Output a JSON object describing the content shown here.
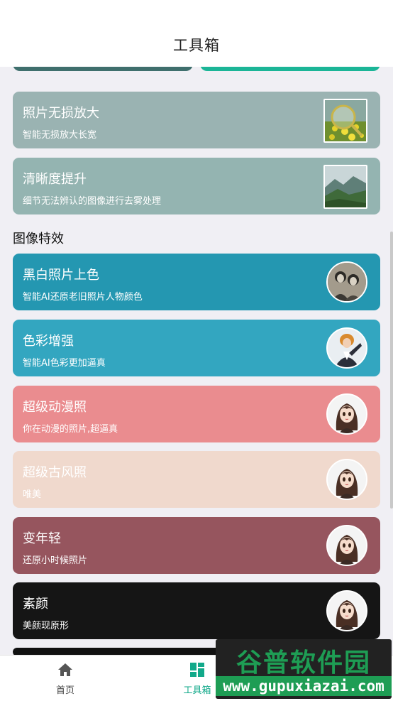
{
  "header": {
    "title": "工具箱"
  },
  "cards_upper": [
    {
      "title": "照片无损放大",
      "subtitle": "智能无损放大长宽",
      "color": "#9ab3b2",
      "thumb": "magnifier-flower-field-thumbnail"
    },
    {
      "title": "清晰度提升",
      "subtitle": "细节无法辨认的图像进行去雾处理",
      "color": "#94b4b1",
      "thumb": "mountain-landscape-thumbnail"
    }
  ],
  "section": {
    "title": "图像特效"
  },
  "effects": [
    {
      "title": "黑白照片上色",
      "subtitle": "智能AI还原老旧照片人物颜色",
      "color": "#2497b1",
      "thumb": "bw-portrait-avatar"
    },
    {
      "title": "色彩增强",
      "subtitle": "智能AI色彩更加逼真",
      "color": "#33a6c0",
      "thumb": "woman-portrait-avatar"
    },
    {
      "title": "超级动漫照",
      "subtitle": "你在动漫的照片,超逼真",
      "color": "#ea8c8f",
      "thumb": "anime-girl-avatar"
    },
    {
      "title": "超级古风照",
      "subtitle": "唯美",
      "color": "#f0d9cd",
      "thumb": "anime-girl-avatar"
    },
    {
      "title": "变年轻",
      "subtitle": "还原小时候照片",
      "color": "#96555e",
      "thumb": "anime-girl-avatar"
    },
    {
      "title": "素颜",
      "subtitle": "美颜现原形",
      "color": "#151515",
      "thumb": "anime-girl-avatar"
    }
  ],
  "nav": {
    "home": {
      "label": "首页",
      "icon": "home-icon"
    },
    "tools": {
      "label": "工具箱",
      "icon": "grid-icon",
      "active_color": "#12a98a"
    }
  },
  "watermark": {
    "line1": "谷普软件园",
    "line2": "www.gupuxiazai.com"
  }
}
